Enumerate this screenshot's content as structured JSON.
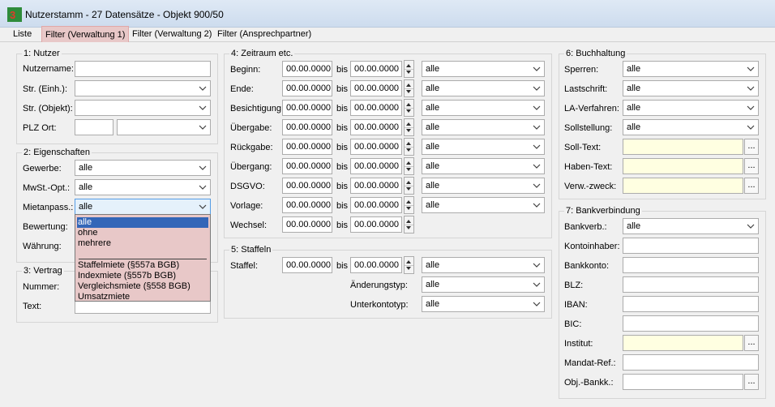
{
  "window": {
    "title": "Nutzerstamm - 27 Datensätze - Objekt 900/50"
  },
  "tabs": [
    {
      "label": "Liste"
    },
    {
      "label": "Filter (Verwaltung 1)"
    },
    {
      "label": "Filter (Verwaltung 2)"
    },
    {
      "label": "Filter (Ansprechpartner)"
    }
  ],
  "nutzer": {
    "title": "1: Nutzer",
    "nutzername_label": "Nutzername:",
    "nutzername_value": "",
    "str_einh_label": "Str. (Einh.):",
    "str_einh_value": "",
    "str_objekt_label": "Str. (Objekt):",
    "str_objekt_value": "",
    "plz_label": "PLZ Ort:",
    "plz_value": "",
    "ort_value": ""
  },
  "eigenschaften": {
    "title": "2: Eigenschaften",
    "gewerbe_label": "Gewerbe:",
    "gewerbe_value": "alle",
    "mwst_label": "MwSt.-Opt.:",
    "mwst_value": "alle",
    "mietanpass_label": "Mietanpass.:",
    "mietanpass_value": "alle",
    "bewertung_label": "Bewertung:",
    "waehrung_label": "Währung:"
  },
  "mietanpass_options": {
    "group1": [
      "alle",
      "ohne",
      "mehrere"
    ],
    "group2": [
      "Staffelmiete (§557a BGB)",
      "Indexmiete (§557b BGB)",
      "Vergleichsmiete (§558 BGB)",
      "Umsatzmiete"
    ]
  },
  "vertrag": {
    "title": "3: Vertrag",
    "nummer_label": "Nummer:",
    "text_label": "Text:",
    "text_value": ""
  },
  "zeitraum": {
    "title": "4: Zeitraum etc.",
    "bis_label": "bis",
    "rows": [
      {
        "label": "Beginn:",
        "from": "00.00.0000",
        "to": "00.00.0000",
        "filter": "alle"
      },
      {
        "label": "Ende:",
        "from": "00.00.0000",
        "to": "00.00.0000",
        "filter": "alle"
      },
      {
        "label": "Besichtigung:",
        "from": "00.00.0000",
        "to": "00.00.0000",
        "filter": "alle"
      },
      {
        "label": "Übergabe:",
        "from": "00.00.0000",
        "to": "00.00.0000",
        "filter": "alle"
      },
      {
        "label": "Rückgabe:",
        "from": "00.00.0000",
        "to": "00.00.0000",
        "filter": "alle"
      },
      {
        "label": "Übergang:",
        "from": "00.00.0000",
        "to": "00.00.0000",
        "filter": "alle"
      },
      {
        "label": "DSGVO:",
        "from": "00.00.0000",
        "to": "00.00.0000",
        "filter": "alle"
      },
      {
        "label": "Vorlage:",
        "from": "00.00.0000",
        "to": "00.00.0000",
        "filter": "alle"
      },
      {
        "label": "Wechsel:",
        "from": "00.00.0000",
        "to": "00.00.0000",
        "filter": ""
      }
    ]
  },
  "staffeln": {
    "title": "5: Staffeln",
    "staffel_label": "Staffel:",
    "staffel_from": "00.00.0000",
    "staffel_to": "00.00.0000",
    "staffel_filter": "alle",
    "aenderungstyp_label": "Änderungstyp:",
    "aenderungstyp_value": "alle",
    "unterkontotyp_label": "Unterkontotyp:",
    "unterkontotyp_value": "alle"
  },
  "buchhaltung": {
    "title": "6: Buchhaltung",
    "sperren_label": "Sperren:",
    "sperren_value": "alle",
    "lastschrift_label": "Lastschrift:",
    "lastschrift_value": "alle",
    "la_verfahren_label": "LA-Verfahren:",
    "la_verfahren_value": "alle",
    "sollstellung_label": "Sollstellung:",
    "sollstellung_value": "alle",
    "soll_text_label": "Soll-Text:",
    "haben_text_label": "Haben-Text:",
    "verw_zweck_label": "Verw.-zweck:"
  },
  "bankverbindung": {
    "title": "7: Bankverbindung",
    "bankverb_label": "Bankverb.:",
    "bankverb_value": "alle",
    "kontoinhaber_label": "Kontoinhaber:",
    "bankkonto_label": "Bankkonto:",
    "blz_label": "BLZ:",
    "iban_label": "IBAN:",
    "bic_label": "BIC:",
    "institut_label": "Institut:",
    "mandat_label": "Mandat-Ref.:",
    "obj_bankk_label": "Obj.-Bankk.:"
  },
  "ellipsis": "...",
  "colors": {
    "active_tab": "#e8c8c8",
    "yellow_field": "#ffffe1",
    "selection": "#3366b8"
  }
}
